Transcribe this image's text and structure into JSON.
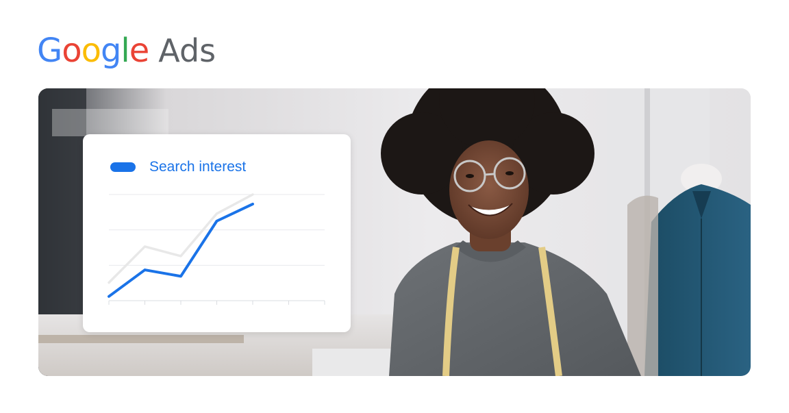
{
  "logo": {
    "letters": [
      {
        "char": "G",
        "color": "#4285F4"
      },
      {
        "char": "o",
        "color": "#EA4335"
      },
      {
        "char": "o",
        "color": "#FBBC05"
      },
      {
        "char": "g",
        "color": "#4285F4"
      },
      {
        "char": "l",
        "color": "#34A853"
      },
      {
        "char": "e",
        "color": "#EA4335"
      }
    ],
    "product": "Ads"
  },
  "chart_data": {
    "type": "line",
    "title": "",
    "xlabel": "",
    "ylabel": "",
    "grid": true,
    "legend_position": "top-left",
    "x": [
      1,
      2,
      3,
      4,
      5,
      6,
      7
    ],
    "ylim": [
      0,
      100
    ],
    "series": [
      {
        "name": "Search interest",
        "color": "#1a73e8",
        "values": [
          4,
          29,
          23,
          75,
          91
        ]
      },
      {
        "name": "",
        "color": "#e8e8e8",
        "values": [
          17,
          51,
          42,
          82,
          100
        ]
      }
    ]
  }
}
